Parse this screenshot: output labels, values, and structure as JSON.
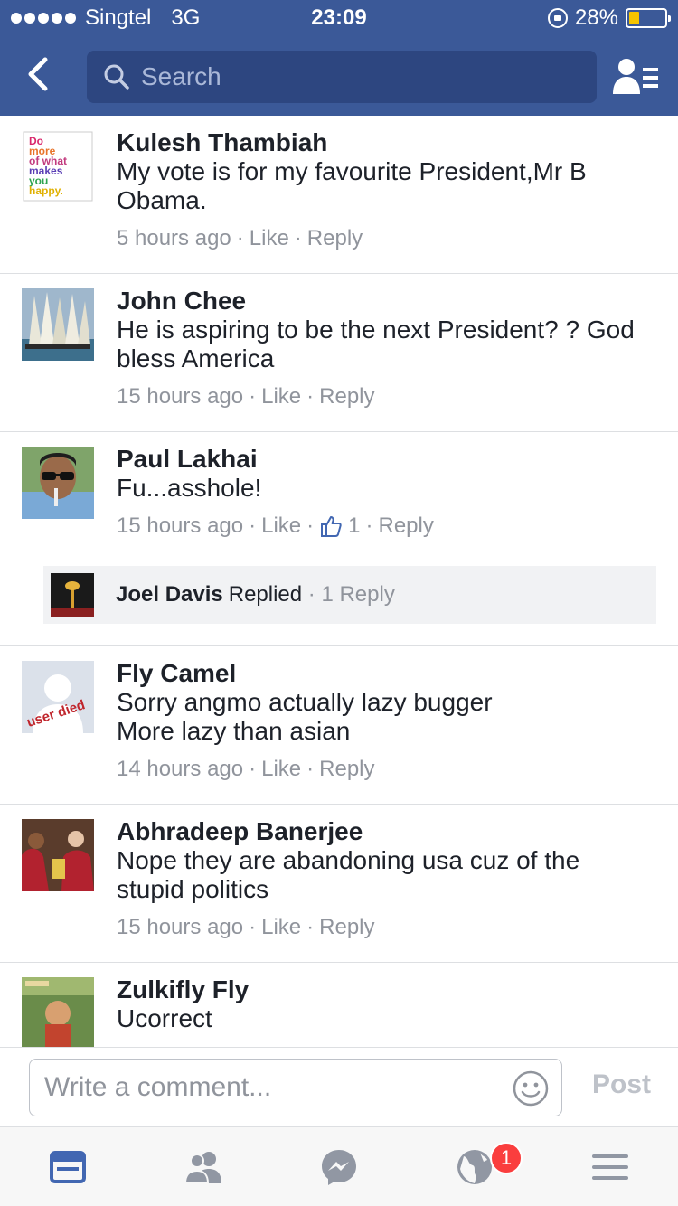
{
  "status_bar": {
    "carrier": "Singtel",
    "network": "3G",
    "time": "23:09",
    "battery": "28%",
    "battery_level": 0.28
  },
  "header": {
    "search_placeholder": "Search"
  },
  "comments": [
    {
      "name": "Kulesh Thambiah",
      "lines": [
        "My vote is for my favourite President,Mr B",
        "Obama."
      ],
      "time": "5 hours ago",
      "like": "Like",
      "reply": "Reply"
    },
    {
      "name": "John Chee",
      "lines": [
        "He is aspiring to be the next President? ? God",
        "bless America"
      ],
      "time": "15 hours ago",
      "like": "Like",
      "reply": "Reply"
    },
    {
      "name": "Paul Lakhai",
      "lines": [
        "Fu...asshole!"
      ],
      "time": "15 hours ago",
      "like": "Like",
      "likes_count": "1",
      "reply": "Reply",
      "replied": {
        "name": "Joel Davis",
        "word": "Replied",
        "count": "1 Reply"
      }
    },
    {
      "name": "Fly Camel",
      "lines": [
        "Sorry angmo actually lazy bugger",
        "More lazy than asian"
      ],
      "time": "14 hours ago",
      "like": "Like",
      "reply": "Reply"
    },
    {
      "name": "Abhradeep Banerjee",
      "lines": [
        "Nope they are abandoning usa cuz of the",
        "stupid politics"
      ],
      "time": "15 hours ago",
      "like": "Like",
      "reply": "Reply"
    },
    {
      "name": "Zulkifly Fly",
      "lines": [
        "Ucorrect"
      ]
    }
  ],
  "composer": {
    "placeholder": "Write a comment...",
    "post_label": "Post"
  },
  "tabbar": {
    "notifications_badge": "1"
  },
  "avatar_art": {
    "kulesh_poster": [
      "Do",
      "more",
      "of what",
      "makes",
      "you",
      "happy."
    ],
    "fly_camel_stamp": "user died"
  },
  "colors": {
    "brand": "#3b5998",
    "link_meta": "#90949c",
    "badge": "#fa3e3e"
  }
}
